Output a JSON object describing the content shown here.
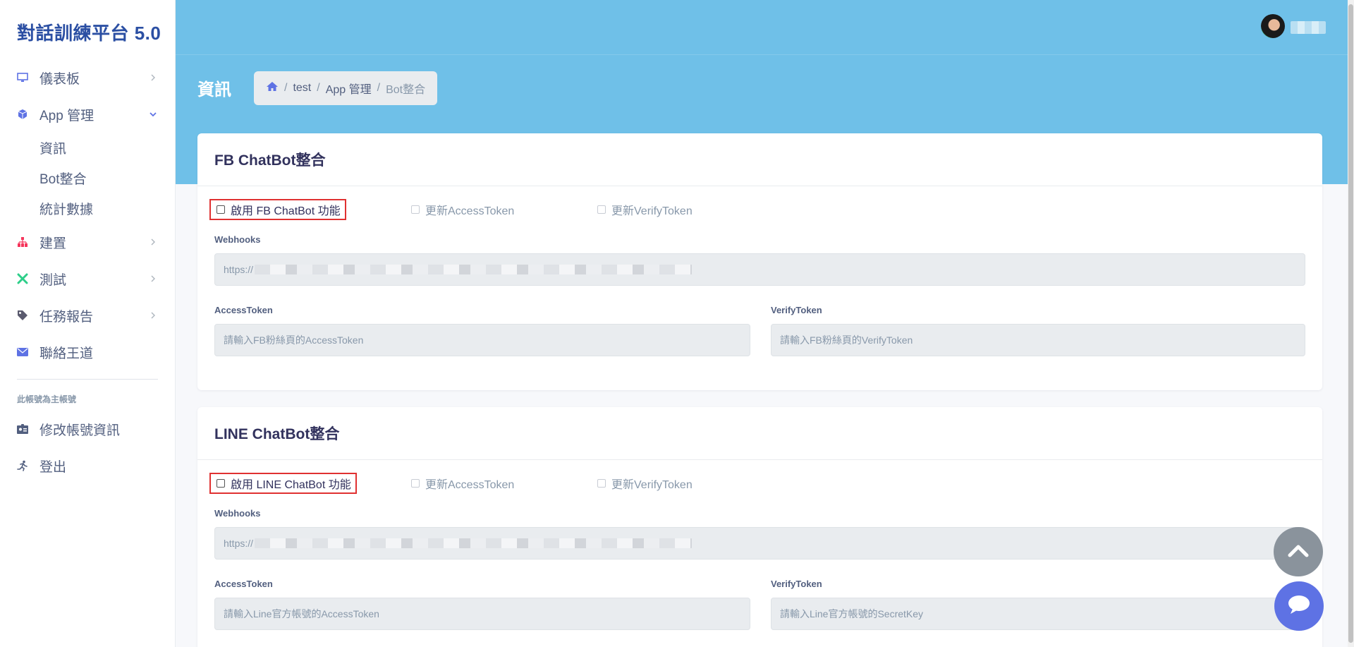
{
  "sidebar": {
    "brand": "對話訓練平台 5.0",
    "items": [
      {
        "label": "儀表板",
        "icon": "monitor-icon"
      },
      {
        "label": "App 管理",
        "icon": "cube-icon"
      },
      {
        "label": "建置",
        "icon": "sitemap-icon"
      },
      {
        "label": "測試",
        "icon": "tools-icon"
      },
      {
        "label": "任務報告",
        "icon": "tag-icon"
      },
      {
        "label": "聯絡王道",
        "icon": "envelope-icon"
      }
    ],
    "sub_items": [
      "資訊",
      "Bot整合",
      "統計數據"
    ],
    "account_label": "此帳號為主帳號",
    "account_items": [
      {
        "label": "修改帳號資訊",
        "icon": "id-card-icon"
      },
      {
        "label": "登出",
        "icon": "running-icon"
      }
    ]
  },
  "header": {
    "page_title": "資訊",
    "breadcrumb": [
      "test",
      "App 管理",
      "Bot整合"
    ]
  },
  "fb": {
    "title": "FB ChatBot整合",
    "enable_label": "啟用 FB ChatBot 功能",
    "update_access_label": "更新AccessToken",
    "update_verify_label": "更新VerifyToken",
    "webhooks_label": "Webhooks",
    "webhooks_value": "https://",
    "access_label": "AccessToken",
    "access_placeholder": "請輸入FB粉絲頁的AccessToken",
    "verify_label": "VerifyToken",
    "verify_placeholder": "請輸入FB粉絲頁的VerifyToken"
  },
  "line": {
    "title": "LINE ChatBot整合",
    "enable_label": "啟用 LINE ChatBot 功能",
    "update_access_label": "更新AccessToken",
    "update_verify_label": "更新VerifyToken",
    "webhooks_label": "Webhooks",
    "webhooks_value": "https://",
    "access_label": "AccessToken",
    "access_placeholder": "請輸入Line官方帳號的AccessToken",
    "verify_label": "VerifyToken",
    "verify_placeholder": "請輸入Line官方帳號的SecretKey"
  },
  "colors": {
    "header_bg": "#6fc0e8",
    "brand": "#2b4fa3",
    "primary": "#5e72e4",
    "highlight_border": "#e03131"
  }
}
